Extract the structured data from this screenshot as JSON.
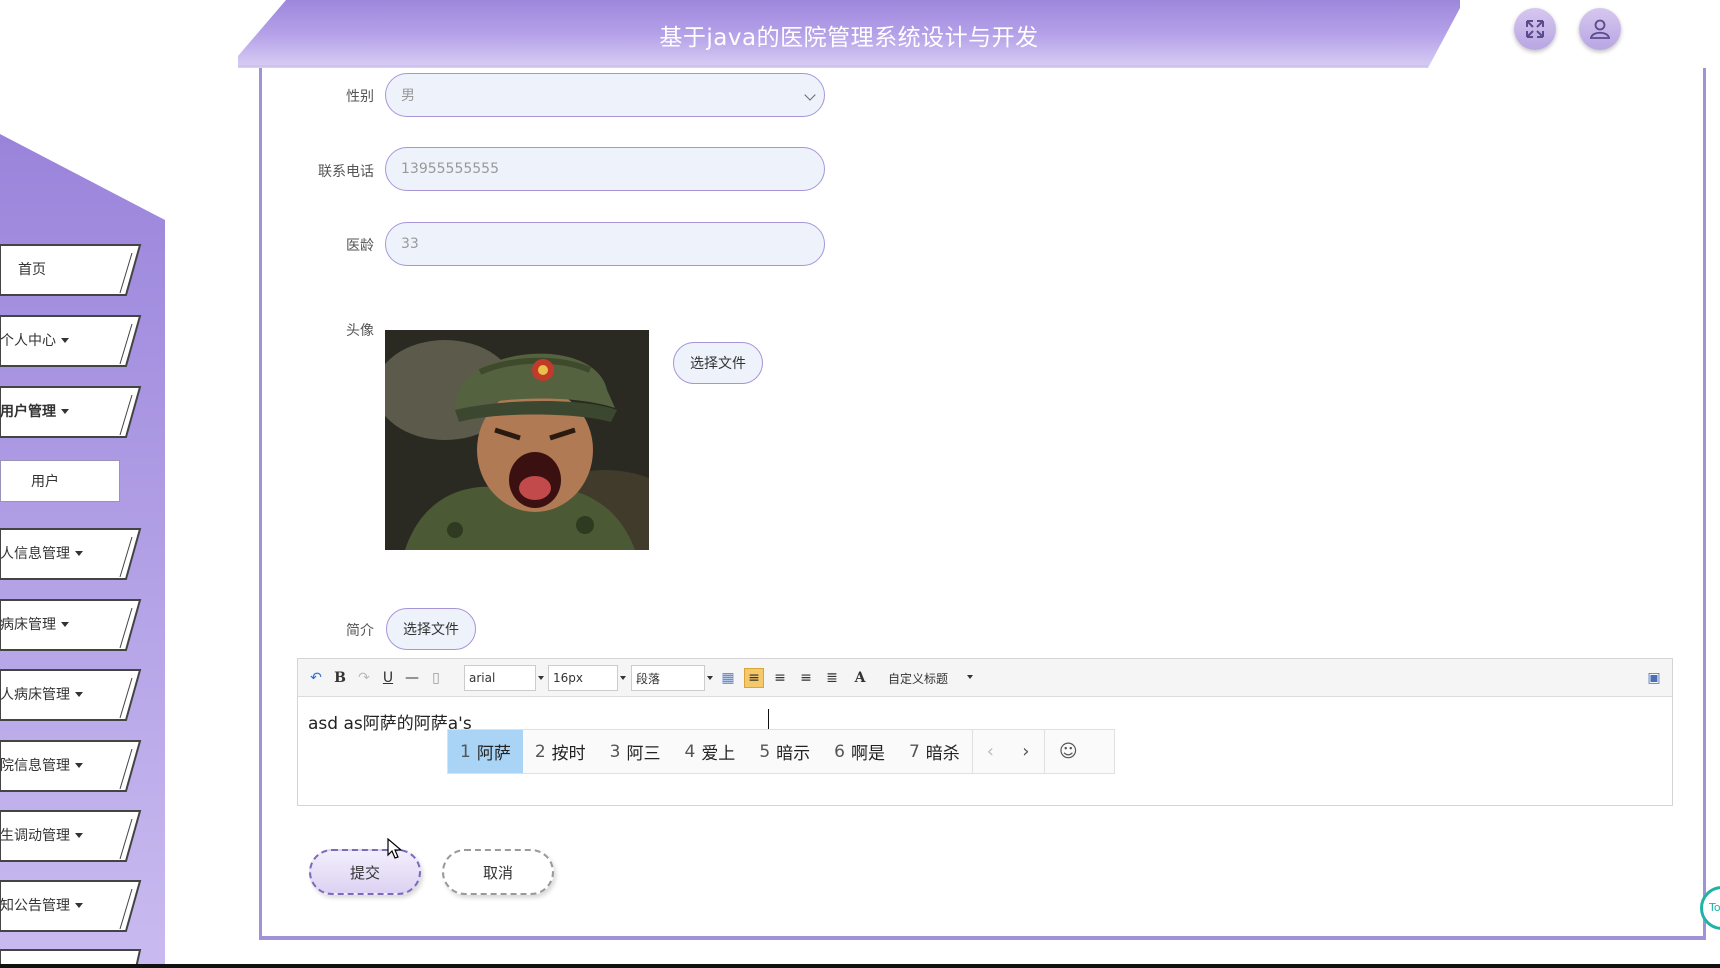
{
  "header": {
    "title": "基于java的医院管理系统设计与开发"
  },
  "header_buttons": {
    "fullscreen_icon": "fullscreen-icon",
    "user_icon": "user-icon"
  },
  "sidebar": {
    "items": [
      {
        "label": "首页",
        "dropdown": false
      },
      {
        "label": "个人中心",
        "dropdown": true
      },
      {
        "label": "用户管理",
        "dropdown": true,
        "bold": true
      },
      {
        "label": "用户",
        "sub": true
      },
      {
        "label": "人信息管理",
        "dropdown": true
      },
      {
        "label": "病床管理",
        "dropdown": true
      },
      {
        "label": "人病床管理",
        "dropdown": true
      },
      {
        "label": "院信息管理",
        "dropdown": true
      },
      {
        "label": "生调动管理",
        "dropdown": true
      },
      {
        "label": "知公告管理",
        "dropdown": true
      }
    ]
  },
  "form": {
    "gender": {
      "label": "性别",
      "value": "男"
    },
    "phone": {
      "label": "联系电话",
      "value": "13955555555"
    },
    "years": {
      "label": "医龄",
      "value": "33"
    },
    "avatar": {
      "label": "头像",
      "button": "选择文件"
    },
    "intro": {
      "label": "简介",
      "button": "选择文件"
    }
  },
  "editor": {
    "font": "arial",
    "size": "16px",
    "paragraph": "段落",
    "heading": "自定义标题",
    "content": "asd as阿萨的阿萨a's"
  },
  "ime": {
    "candidates": [
      {
        "num": "1",
        "text": "阿萨"
      },
      {
        "num": "2",
        "text": "按时"
      },
      {
        "num": "3",
        "text": "阿三"
      },
      {
        "num": "4",
        "text": "爱上"
      },
      {
        "num": "5",
        "text": "暗示"
      },
      {
        "num": "6",
        "text": "啊是"
      },
      {
        "num": "7",
        "text": "暗杀"
      }
    ],
    "prev": "‹",
    "next": "›",
    "emoji": "☺"
  },
  "actions": {
    "submit": "提交",
    "cancel": "取消"
  },
  "corner_widget": "To",
  "colors": {
    "accent": "#a191d6",
    "header": "#b6a3e6"
  }
}
